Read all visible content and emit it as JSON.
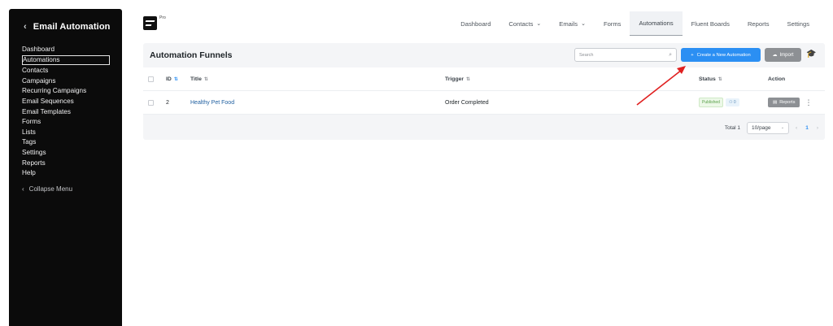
{
  "sidebar": {
    "title": "Email Automation",
    "items": [
      {
        "label": "Dashboard"
      },
      {
        "label": "Automations"
      },
      {
        "label": "Contacts"
      },
      {
        "label": "Campaigns"
      },
      {
        "label": "Recurring Campaigns"
      },
      {
        "label": "Email Sequences"
      },
      {
        "label": "Email Templates"
      },
      {
        "label": "Forms"
      },
      {
        "label": "Lists"
      },
      {
        "label": "Tags"
      },
      {
        "label": "Settings"
      },
      {
        "label": "Reports"
      },
      {
        "label": "Help"
      }
    ],
    "collapse_label": "Collapse Menu"
  },
  "brand": {
    "badge": "Pro"
  },
  "nav": {
    "items": [
      {
        "label": "Dashboard"
      },
      {
        "label": "Contacts"
      },
      {
        "label": "Emails"
      },
      {
        "label": "Forms"
      },
      {
        "label": "Automations"
      },
      {
        "label": "Fluent Boards"
      },
      {
        "label": "Reports"
      },
      {
        "label": "Settings"
      }
    ]
  },
  "panel": {
    "title": "Automation Funnels",
    "search_placeholder": "Search",
    "create_label": "Create a New Automation",
    "import_label": "Import"
  },
  "table": {
    "columns": {
      "id": "ID",
      "title": "Title",
      "trigger": "Trigger",
      "status": "Status",
      "action": "Action"
    },
    "rows": [
      {
        "id": "2",
        "title": "Healthy Pet Food",
        "trigger": "Order Completed",
        "status": "Published",
        "count": "0",
        "action": "Reports"
      }
    ]
  },
  "pagination": {
    "total_label": "Total 1",
    "per_page": "10/page",
    "current_page": "1"
  },
  "colors": {
    "primary": "#2b8ff3",
    "sidebar_bg": "#0b0b0b",
    "annotation": "#e02020"
  }
}
